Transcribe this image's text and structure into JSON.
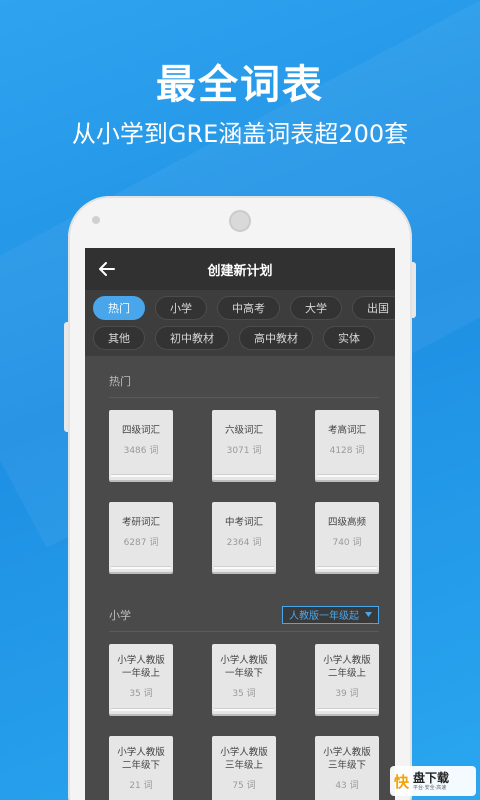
{
  "promo": {
    "headline": "最全词表",
    "subline": "从小学到GRE涵盖词表超200套"
  },
  "appbar": {
    "title": "创建新计划"
  },
  "chips": {
    "row1": [
      "热门",
      "小学",
      "中高考",
      "大学",
      "出国"
    ],
    "row2": [
      "其他",
      "初中教材",
      "高中教材",
      "实体"
    ],
    "active": "热门"
  },
  "sections": {
    "hot": {
      "title": "热门",
      "books": [
        {
          "title": "四级词汇",
          "count": "3486 词"
        },
        {
          "title": "六级词汇",
          "count": "3071 词"
        },
        {
          "title": "考高词汇",
          "count": "4128 词"
        },
        {
          "title": "考研词汇",
          "count": "6287 词"
        },
        {
          "title": "中考词汇",
          "count": "2364 词"
        },
        {
          "title": "四级高频",
          "count": "740 词"
        }
      ]
    },
    "primary": {
      "title": "小学",
      "dropdown": "人教版一年级起",
      "books": [
        {
          "line1": "小学人教版",
          "line2": "一年级上",
          "count": "35 词"
        },
        {
          "line1": "小学人教版",
          "line2": "一年级下",
          "count": "35 词"
        },
        {
          "line1": "小学人教版",
          "line2": "二年级上",
          "count": "39 词"
        },
        {
          "line1": "小学人教版",
          "line2": "二年级下",
          "count": "21 词"
        },
        {
          "line1": "小学人教版",
          "line2": "三年级上",
          "count": "75 词"
        },
        {
          "line1": "小学人教版",
          "line2": "三年级下",
          "count": "43 词"
        }
      ]
    }
  },
  "watermark": {
    "logo": "快",
    "name": "盘下载",
    "tagline": "平台·安全·高速"
  },
  "colors": {
    "accent": "#49a6ea",
    "background": "#2fa3ef"
  }
}
